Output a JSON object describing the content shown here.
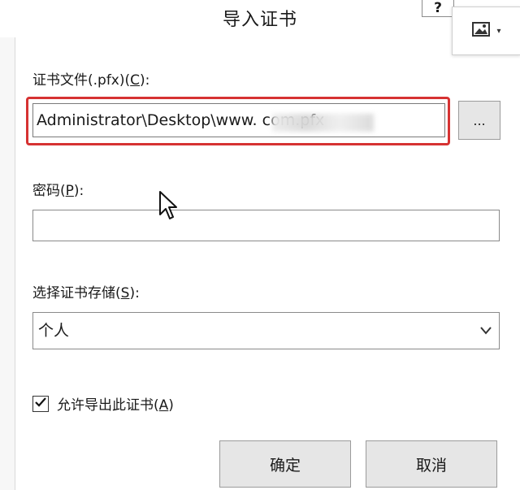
{
  "dialog": {
    "title": "导入证书",
    "help_label": "?"
  },
  "file": {
    "label": "证书文件(.pfx)(",
    "label_key": "C",
    "label_end": "):",
    "value": "Administrator\\Desktop\\www.          com.pfx",
    "browse_label": "..."
  },
  "password": {
    "label": "密码(",
    "label_key": "P",
    "label_end": "):",
    "value": ""
  },
  "store": {
    "label": "选择证书存储(",
    "label_key": "S",
    "label_end": "):",
    "selected": "个人"
  },
  "export": {
    "label": "允许导出此证书(",
    "label_key": "A",
    "label_end": ")",
    "checked": true
  },
  "buttons": {
    "ok": "确定",
    "cancel": "取消"
  },
  "icons": {
    "image_popup": "image-icon",
    "dropdown": "chevron-down-icon",
    "check": "checkmark-icon",
    "cursor": "mouse-pointer-icon"
  },
  "colors": {
    "highlight": "#d63232"
  }
}
